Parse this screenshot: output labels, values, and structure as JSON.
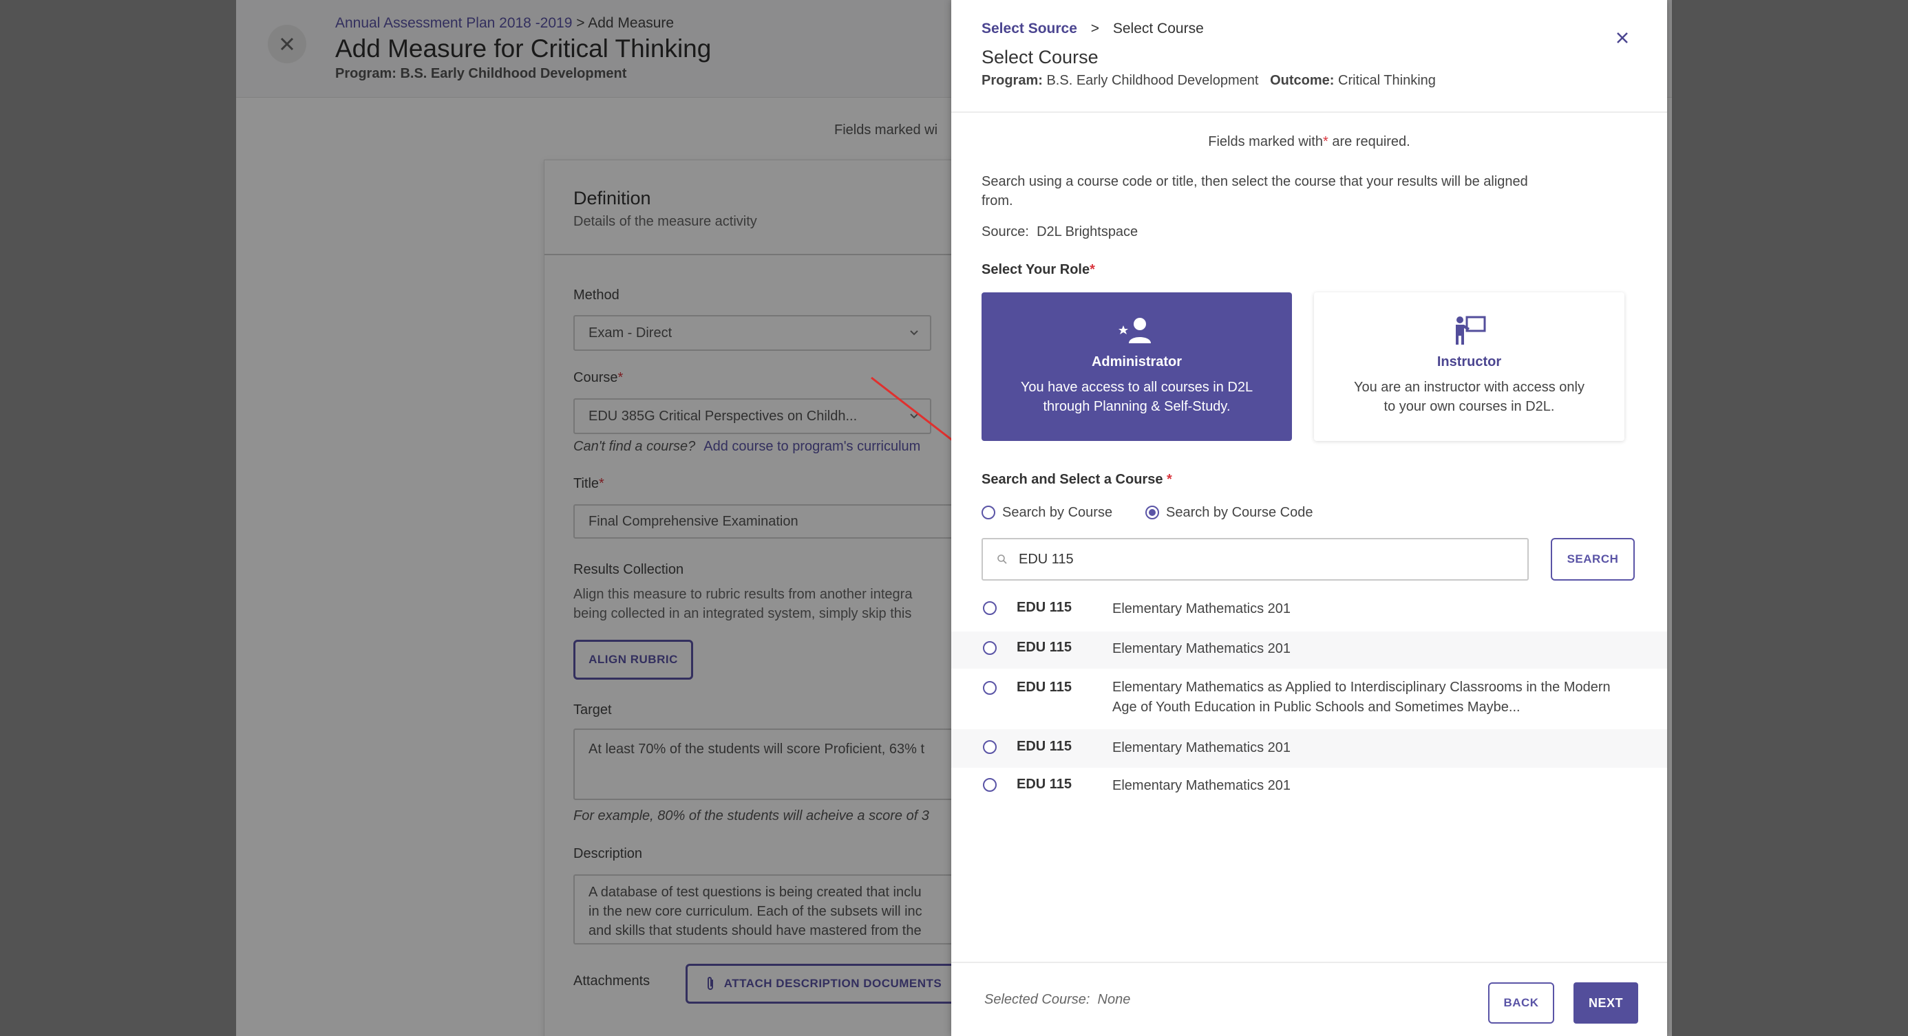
{
  "page": {
    "breadcrumb_link": "Annual Assessment Plan 2018 -2019",
    "breadcrumb_sep": ">",
    "breadcrumb_current": "Add Measure",
    "title": "Add Measure for Critical Thinking",
    "program": "Program: B.S. Early Childhood Development",
    "fields_note": "Fields marked wi"
  },
  "definition": {
    "title": "Definition",
    "subtitle": "Details of the measure activity",
    "method_label": "Method",
    "method_value": "Exam - Direct",
    "course_label": "Course",
    "course_value": "EDU 385G Critical Perspectives on Childh...",
    "cant_find": "Can't find a course?",
    "add_course_link": "Add course to program's curriculum",
    "title_label": "Title",
    "title_value": "Final Comprehensive Examination",
    "results_label": "Results Collection",
    "results_line1": "Align this measure to rubric results from another integra",
    "results_line2": "being collected in an integrated system, simply skip this",
    "align_rubric": "ALIGN RUBRIC",
    "target_label": "Target",
    "target_value": "At least 70% of the students will score Proficient, 63% t",
    "target_hint": "For example, 80% of the students will acheive a score of 3",
    "description_label": "Description",
    "description_lines": [
      "A database of test questions is being created that inclu",
      "in the new core curriculum.  Each of the subsets will inc",
      "and skills that students should have mastered from the"
    ],
    "attachments_label": "Attachments",
    "attach_button": "ATTACH DESCRIPTION DOCUMENTS"
  },
  "modal": {
    "crumb_link": "Select Source",
    "crumb_sep": ">",
    "crumb_current": "Select Course",
    "title": "Select Course",
    "program_label": "Program:",
    "program_value": "B.S. Early Childhood Development",
    "outcome_label": "Outcome:",
    "outcome_value": "Critical Thinking",
    "required_prefix": "Fields marked with",
    "required_suffix": "are required.",
    "instructions_line1": "Search using a course code or title, then select the course that your results will be aligned",
    "instructions_line2": "from.",
    "source_label": "Source:",
    "source_value": "D2L Brightspace",
    "role_label": "Select Your Role",
    "roles": [
      {
        "icon": "person-star-icon",
        "title": "Administrator",
        "desc_line1": "You have access to all courses in D2L",
        "desc_line2": "through Planning & Self-Study."
      },
      {
        "icon": "instructor-board-icon",
        "title": "Instructor",
        "desc_line1": "You are an instructor with access only",
        "desc_line2": "to your own courses in D2L."
      }
    ],
    "search_label": "Search and Select a Course",
    "search_by_course": "Search by Course",
    "search_by_code": "Search by Course Code",
    "search_value": "EDU 115",
    "search_button": "SEARCH",
    "results": [
      {
        "code": "EDU 115",
        "title": "Elementary Mathematics 201"
      },
      {
        "code": "EDU 115",
        "title": "Elementary Mathematics 201"
      },
      {
        "code": "EDU 115",
        "title": "Elementary Mathematics as Applied to Interdisciplinary Classrooms in the Modern Age of Youth Education in Public Schools and Sometimes Maybe..."
      },
      {
        "code": "EDU 115",
        "title": "Elementary Mathematics 201"
      },
      {
        "code": "EDU 115",
        "title": "Elementary Mathematics 201"
      }
    ],
    "selected_label": "Selected Course:",
    "selected_value": "None",
    "back_button": "BACK",
    "next_button": "NEXT"
  },
  "colors": {
    "accent": "#534e9b",
    "required": "#d9363e",
    "annotation_arrow": "#e0302e"
  }
}
